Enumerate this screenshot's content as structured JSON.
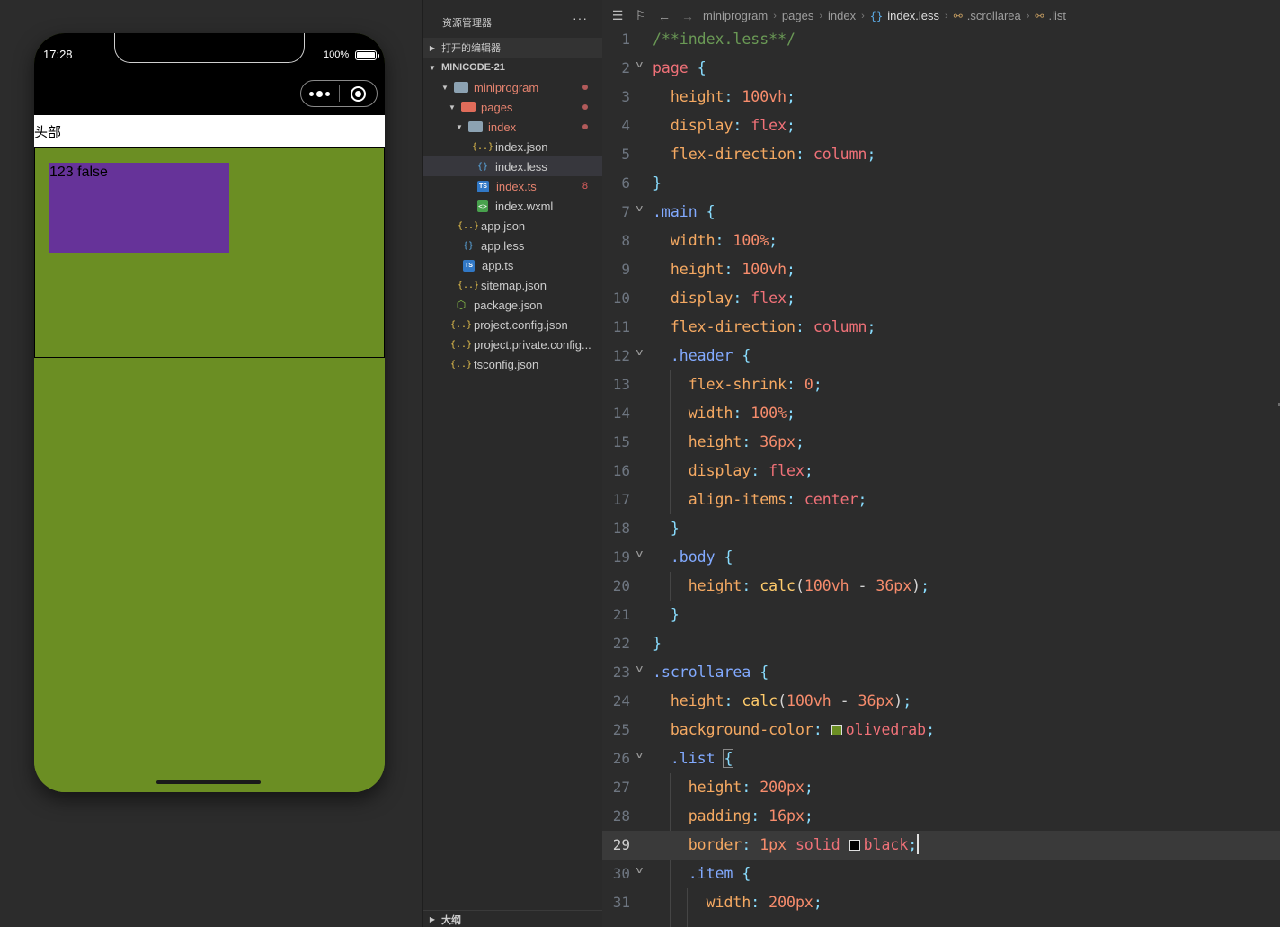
{
  "simulator": {
    "time": "17:28",
    "battery_pct": "100%",
    "header_text": "头部",
    "item_text": "123 false"
  },
  "explorer": {
    "title": "资源管理器",
    "more": "···",
    "open_editors": "打开的编辑器",
    "project": "MINICODE-21",
    "outline": "大纲",
    "tree": {
      "miniprogram": "miniprogram",
      "pages": "pages",
      "index": "index",
      "index_json": "index.json",
      "index_less": "index.less",
      "index_ts": "index.ts",
      "index_ts_errors": "8",
      "index_wxml": "index.wxml",
      "app_json": "app.json",
      "app_less": "app.less",
      "app_ts": "app.ts",
      "sitemap_json": "sitemap.json",
      "package_json": "package.json",
      "project_config_json": "project.config.json",
      "project_private_config": "project.private.config...",
      "tsconfig_json": "tsconfig.json"
    }
  },
  "breadcrumb": {
    "items": [
      "miniprogram",
      "pages",
      "index",
      "index.less",
      ".scrollarea",
      ".list"
    ]
  },
  "editor": {
    "current_line": 29,
    "lines": {
      "1": "1",
      "2": "2",
      "3": "3",
      "4": "4",
      "5": "5",
      "6": "6",
      "7": "7",
      "8": "8",
      "9": "9",
      "10": "10",
      "11": "11",
      "12": "12",
      "13": "13",
      "14": "14",
      "15": "15",
      "16": "16",
      "17": "17",
      "18": "18",
      "19": "19",
      "20": "20",
      "21": "21",
      "22": "22",
      "23": "23",
      "24": "24",
      "25": "25",
      "26": "26",
      "27": "27",
      "28": "28",
      "29": "29",
      "30": "30",
      "31": "31"
    },
    "colors": {
      "olivedrab": "#6b8e23",
      "black": "#000000",
      "rebeccapurple": "#663399"
    }
  }
}
